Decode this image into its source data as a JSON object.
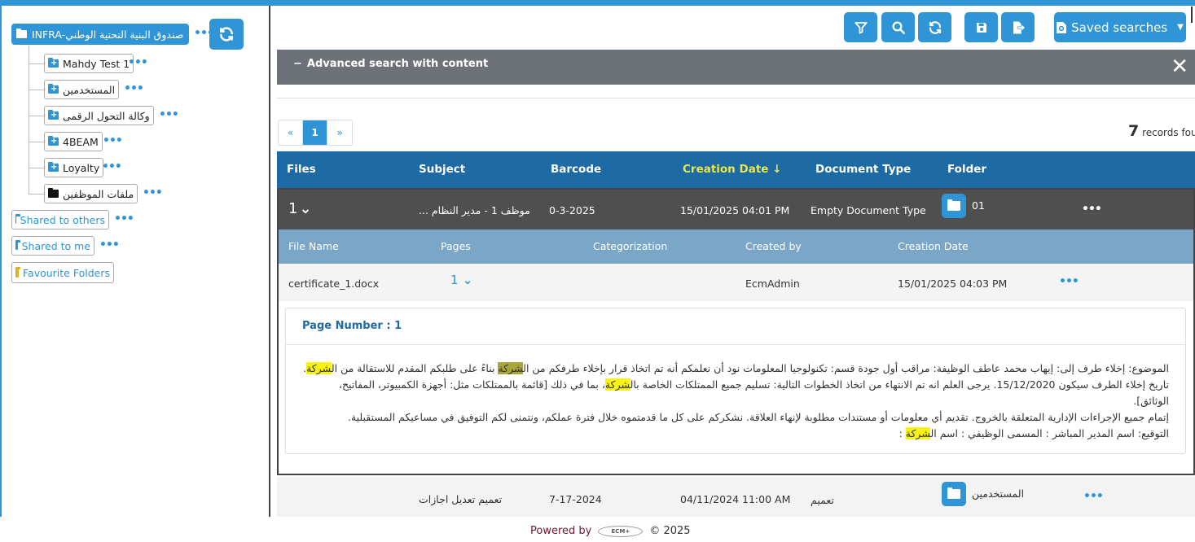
{
  "tree": {
    "root_label": "INFRA-صندوق البنية التحتية الوطني",
    "children": [
      {
        "label": "Mahdy Test 1"
      },
      {
        "label": "المستخدمين"
      },
      {
        "label": "وكالة التحول الرقمى"
      },
      {
        "label": "4BEAM"
      },
      {
        "label": "Loyalty"
      },
      {
        "label": "ملفات الموظفين"
      }
    ],
    "top_items": [
      {
        "label": "Shared to others"
      },
      {
        "label": "Shared to me"
      },
      {
        "label": "Favourite Folders"
      }
    ]
  },
  "toolbar": {
    "saved_searches_label": "Saved searches",
    "icons": [
      "filter-icon",
      "search-icon",
      "refresh-icon",
      "save-icon",
      "export-icon"
    ]
  },
  "advanced_search": {
    "title": "Advanced search with content"
  },
  "pagination": {
    "prev": "«",
    "current": "1",
    "next": "»"
  },
  "records": {
    "count": "7",
    "label": "records foun"
  },
  "table": {
    "headers": [
      "Files",
      "Subject",
      "Barcode",
      "Creation Date",
      "Document Type",
      "Folder"
    ],
    "sorted_column": "Creation Date",
    "rows": [
      {
        "files": "1",
        "subject": "... موظف 1 - مدير النظام",
        "barcode": "0-3-2025",
        "creation_date": "15/01/2025 04:01 PM",
        "document_type": "Empty Document Type",
        "folder": "01"
      },
      {
        "files": "",
        "subject": "تعميم تعديل اجازات",
        "barcode": "7-17-2024",
        "creation_date": "04/11/2024 11:00 AM",
        "document_type": "تعميم",
        "folder": "المستخدمين"
      }
    ]
  },
  "file_table": {
    "headers": [
      "File Name",
      "Pages",
      "Categorization",
      "Created by",
      "Creation Date"
    ],
    "row": {
      "file_name": "certificate_1.docx",
      "pages": "1",
      "categorization": "",
      "created_by": "EcmAdmin",
      "creation_date": "15/01/2025 04:03 PM"
    }
  },
  "page_content": {
    "title": "Page Number : 1",
    "line1_a": "الموضوع: إخلاء طرف إلى: إيهاب محمد عاطف الوظيفة: مراقب أول جودة قسم: تكنولوجيا المعلومات نود أن نعلمكم أنه تم اتخاذ قرار بإخلاء طرفكم من ال",
    "line1_hl1": "شركة",
    "line1_b": " بناءً على طلبكم المقدم للاستقالة من ال",
    "line1_hl2": "شركة",
    "line1_c": ".",
    "line2_a": "تاريخ إخلاء الطرف سيكون 15/12/2020. يرجى العلم انه تم الانتهاء من اتخاذ الخطوات التالية: تسليم جميع الممتلكات الخاصة بال",
    "line2_hl": "شركة",
    "line2_b": "، بما في ذلك [قائمة بالممتلكات مثل: أجهزة الكمبيوتر، المفاتيح، الوثائق].",
    "line3": "إتمام جميع الإجراءات الإدارية المتعلقة بالخروج. تقديم أي معلومات أو مستندات مطلوبة لإنهاء العلاقة. نشكركم على كل ما قدمتموه خلال فترة عملكم، ونتمنى لكم التوفيق في مساعيكم المستقبلية.",
    "line4_a": "التوقيع: اسم المدير المباشر : المسمى الوظيفي : اسم ال",
    "line4_hl": "شركة",
    "line4_b": " :"
  },
  "footer": {
    "powered_by": "Powered by",
    "logo_text": "ECM+",
    "year": "© 2025"
  },
  "colors": {
    "primary": "#2f95d6",
    "header": "#1d6aa5",
    "highlight": "#f8f310",
    "sorted_header": "#e8e84a"
  }
}
